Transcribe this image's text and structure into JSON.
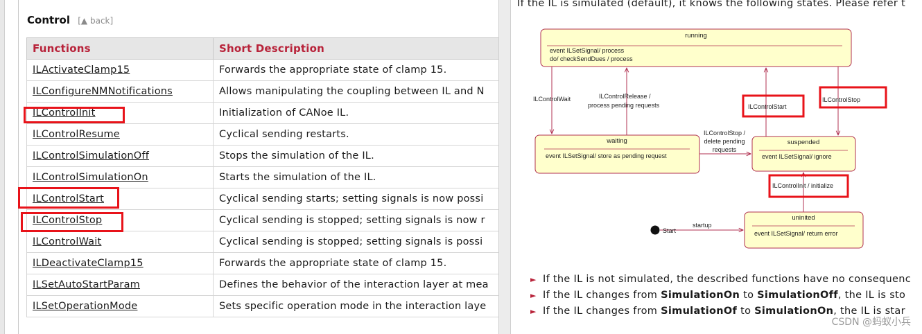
{
  "left": {
    "heading": "Control",
    "back_link": "[▲ back]",
    "columns": [
      "Functions",
      "Short Description"
    ],
    "rows": [
      {
        "fn": "ILActivateClamp15",
        "desc": "Forwards the appropriate state of clamp 15."
      },
      {
        "fn": "ILConfigureNMNotifications",
        "desc": "Allows manipulating the coupling between IL and N"
      },
      {
        "fn": "ILControlInit",
        "desc": "Initialization of CANoe IL."
      },
      {
        "fn": "ILControlResume",
        "desc": "Cyclical sending restarts."
      },
      {
        "fn": "ILControlSimulationOff",
        "desc": "Stops the simulation of the IL."
      },
      {
        "fn": "ILControlSimulationOn",
        "desc": "Starts the simulation of the IL."
      },
      {
        "fn": "ILControlStart",
        "desc": "Cyclical sending starts; setting signals is now possi"
      },
      {
        "fn": "ILControlStop",
        "desc": "Cyclical sending is stopped; setting signals is now r"
      },
      {
        "fn": "ILControlWait",
        "desc": "Cyclical sending is stopped; setting signals is possi"
      },
      {
        "fn": "ILDeactivateClamp15",
        "desc": "Forwards the appropriate state of clamp 15."
      },
      {
        "fn": "ILSetAutoStartParam",
        "desc": "Defines the behavior of the interaction layer at mea"
      },
      {
        "fn": "ILSetOperationMode",
        "desc": "Sets specific operation mode in the interaction laye"
      }
    ]
  },
  "right": {
    "intro": "If the IL is simulated (default), it knows the following states. Please refer t",
    "diagram": {
      "running": {
        "name": "running",
        "line1": "event ILSetSignal/ process",
        "line2": "do/ checkSendDues / process"
      },
      "waiting": {
        "name": "waiting",
        "line1": "event ILSetSignal/ store as pending request"
      },
      "suspended": {
        "name": "suspended",
        "line1": "event ILSetSignal/ ignore"
      },
      "uninited": {
        "name": "uninited",
        "line1": "event ILSetSignal/ return error"
      },
      "labels": {
        "wait": "ILControlWait",
        "release1": "ILControlRelease /",
        "release2": "process pending requests",
        "start": "ILControlStart",
        "stop": "ILControlStop",
        "stopdel1": "ILControlStop /",
        "stopdel2": "delete pending",
        "stopdel3": "requests",
        "init": "ILControlInit / initialize",
        "startup": "startup",
        "start_node": "Start"
      }
    },
    "bullets": [
      {
        "pre": "If the IL is not simulated, the described functions have no consequenc",
        "b1": "",
        "mid": "",
        "b2": "",
        "post": ""
      },
      {
        "pre": "If the IL changes from ",
        "b1": "SimulationOn",
        "mid": " to ",
        "b2": "SimulationOff",
        "post": ", the IL is sto"
      },
      {
        "pre": "If the IL changes from ",
        "b1": "SimulationOf",
        "mid": " to ",
        "b2": "SimulationOn",
        "post": ", the IL is star"
      }
    ],
    "watermark": "CSDN @蚂蚁小兵"
  }
}
